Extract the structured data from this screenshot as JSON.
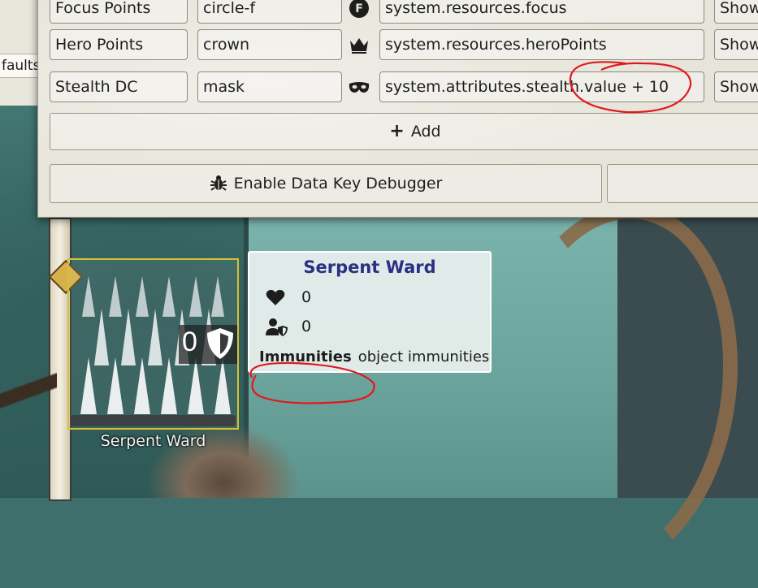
{
  "partial_window": {
    "text": "faults"
  },
  "settings": {
    "rows": [
      {
        "name": "Focus Points",
        "icon": "circle-f",
        "glyph": "circle-f-icon",
        "path": "system.resources.focus",
        "show": "Show"
      },
      {
        "name": "Hero Points",
        "icon": "crown",
        "glyph": "crown-icon",
        "path": "system.resources.heroPoints",
        "show": "Show"
      },
      {
        "name": "Stealth DC",
        "icon": "mask",
        "glyph": "mask-icon",
        "path": "system.attributes.stealth.value + 10",
        "show": "Show"
      }
    ],
    "add_label": "Add",
    "debug_label": "Enable Data Key Debugger"
  },
  "token": {
    "name": "Serpent Ward",
    "count": "0"
  },
  "tooltip": {
    "title": "Serpent Ward",
    "hp": "0",
    "ac": "0",
    "immunities_label": "Immunities",
    "immunities_value": "object immunities"
  },
  "colors": {
    "tooltip_title": "#2b2f85",
    "token_border": "#d6c034",
    "annotation": "#e0191f"
  }
}
